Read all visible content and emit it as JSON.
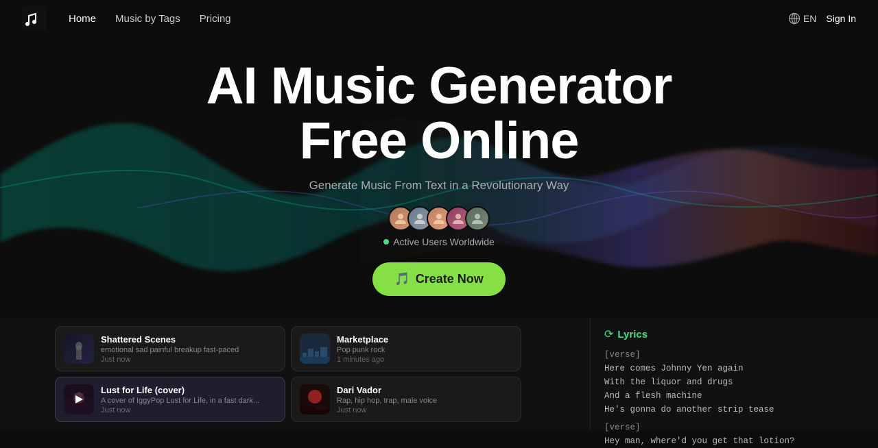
{
  "navbar": {
    "logo_alt": "Music Logo",
    "links": [
      {
        "label": "Home",
        "active": true
      },
      {
        "label": "Music by Tags",
        "active": false
      },
      {
        "label": "Pricing",
        "active": false
      }
    ],
    "lang": "EN",
    "sign_in": "Sign In"
  },
  "hero": {
    "title_line1": "AI Music Generator",
    "title_line2": "Free Online",
    "subtitle": "Generate Music From Text in a Revolutionary Way",
    "active_users_label": "Active Users Worldwide",
    "cta_label": "Create Now"
  },
  "cards": [
    {
      "id": "shattered-scenes",
      "title": "Shattered Scenes",
      "tags": "emotional sad painful breakup fast-paced",
      "time": "Just now",
      "thumb_style": "dark",
      "selected": false
    },
    {
      "id": "marketplace",
      "title": "Marketplace",
      "tags": "Pop punk rock",
      "time": "1 minutes ago",
      "thumb_style": "city",
      "selected": false
    },
    {
      "id": "lust-for-life",
      "title": "Lust for Life (cover)",
      "tags": "A cover of IggyPop Lust for Life, in a fast dark...",
      "time": "Just now",
      "thumb_style": "pink",
      "selected": true
    },
    {
      "id": "dari-vador",
      "title": "Dari Vador",
      "tags": "Rap, hip hop, trap, male voice",
      "time": "Just now",
      "thumb_style": "red",
      "selected": false
    }
  ],
  "lyrics": {
    "title": "Lyrics",
    "lines": [
      {
        "type": "label",
        "text": "[verse]"
      },
      {
        "type": "line",
        "text": "Here comes Johnny Yen again"
      },
      {
        "type": "line",
        "text": "With the liquor and drugs"
      },
      {
        "type": "line",
        "text": "And a flesh machine"
      },
      {
        "type": "line",
        "text": "He's gonna do another strip tease"
      },
      {
        "type": "label",
        "text": "[verse]"
      },
      {
        "type": "line",
        "text": "Hey man, where'd you get that lotion?"
      }
    ]
  }
}
